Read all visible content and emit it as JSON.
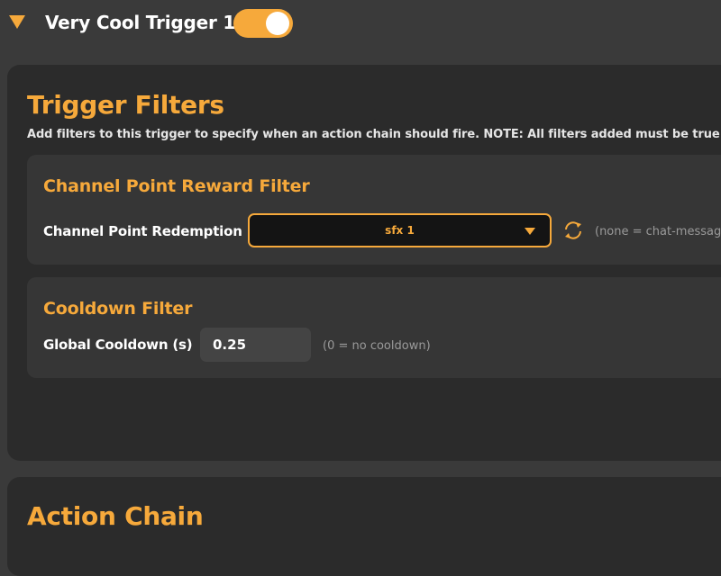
{
  "trigger": {
    "name": "Very Cool Trigger 1",
    "enabled": true,
    "collapse_icon": "triangle-down-icon"
  },
  "filters_section": {
    "title": "Trigger Filters",
    "description": "Add filters to this trigger to specify when an action chain should fire. NOTE: All filters added must be true a"
  },
  "reward_filter": {
    "title": "Channel Point Reward Filter",
    "label": "Channel Point Redemption",
    "selected": "sfx 1",
    "refresh_icon": "refresh-icon",
    "hint": "(none = chat-message"
  },
  "cooldown_filter": {
    "title": "Cooldown Filter",
    "label": "Global Cooldown (s)",
    "value": "0.25",
    "hint": "(0 = no cooldown)"
  },
  "action_section": {
    "title": "Action Chain"
  },
  "colors": {
    "accent": "#f6a93b",
    "background": "#3a3a3a",
    "panel": "#2b2b2b",
    "card": "#363636"
  }
}
